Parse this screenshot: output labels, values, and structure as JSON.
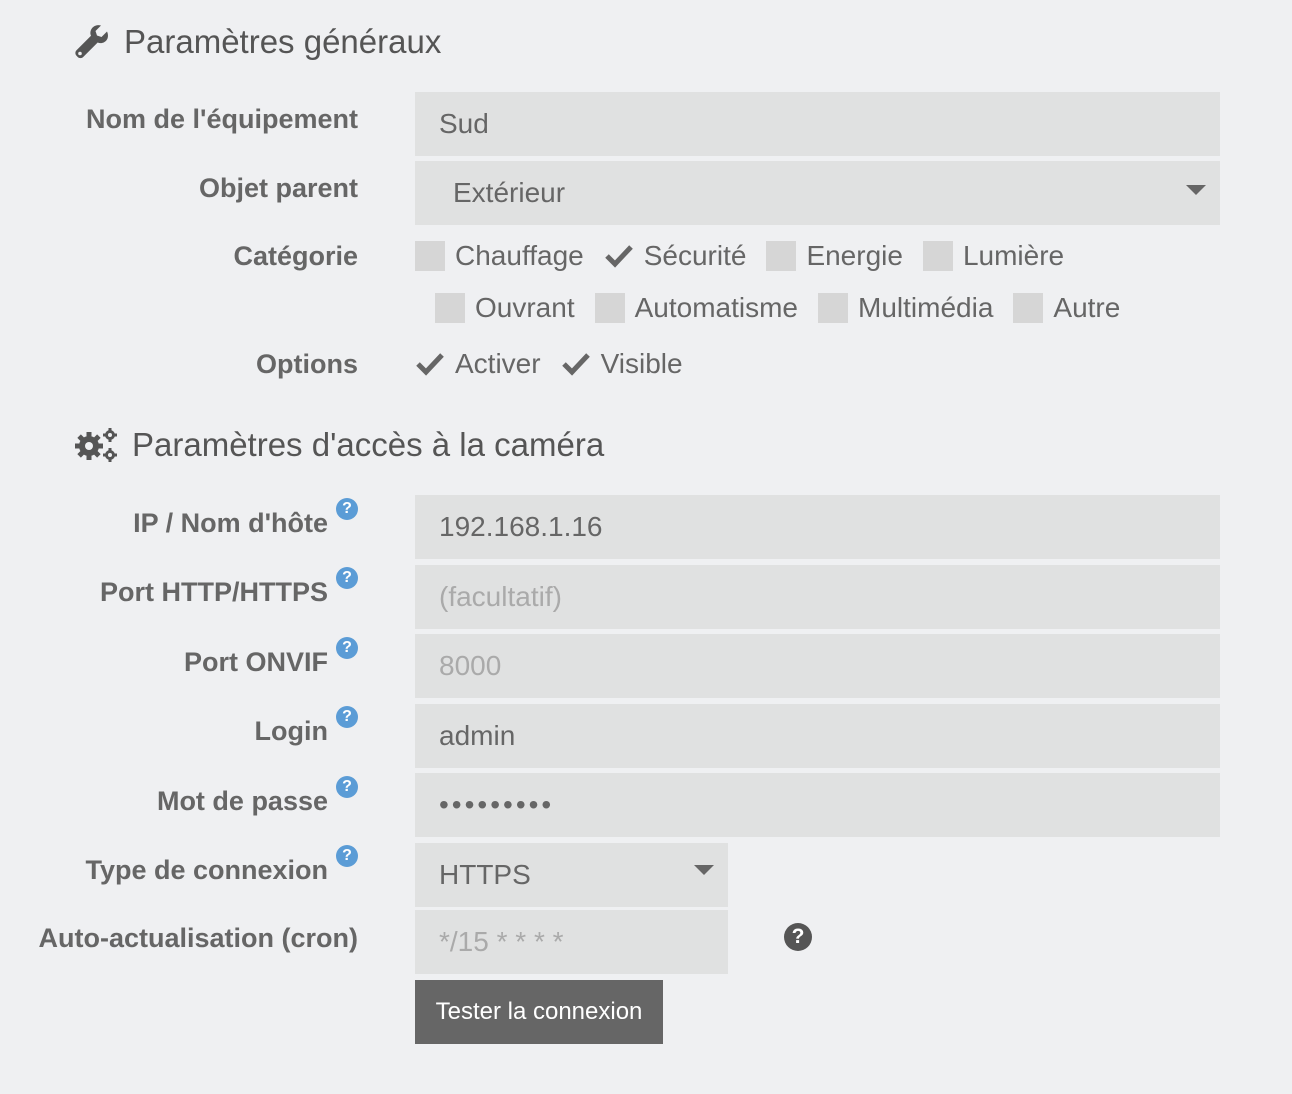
{
  "general": {
    "title": "Paramètres généraux",
    "name_label": "Nom de l'équipement",
    "name_value": "Sud",
    "parent_label": "Objet parent",
    "parent_value": "Extérieur",
    "category_label": "Catégorie",
    "categories": [
      {
        "label": "Chauffage",
        "checked": false
      },
      {
        "label": "Sécurité",
        "checked": true
      },
      {
        "label": "Energie",
        "checked": false
      },
      {
        "label": "Lumière",
        "checked": false
      },
      {
        "label": "Ouvrant",
        "checked": false
      },
      {
        "label": "Automatisme",
        "checked": false
      },
      {
        "label": "Multimédia",
        "checked": false
      },
      {
        "label": "Autre",
        "checked": false
      }
    ],
    "options_label": "Options",
    "options": [
      {
        "label": "Activer",
        "checked": true
      },
      {
        "label": "Visible",
        "checked": true
      }
    ]
  },
  "camera": {
    "title": "Paramètres d'accès à la caméra",
    "ip_label": "IP / Nom d'hôte",
    "ip_value": "192.168.1.16",
    "http_port_label": "Port HTTP/HTTPS",
    "http_port_placeholder": "(facultatif)",
    "onvif_port_label": "Port ONVIF",
    "onvif_port_placeholder": "8000",
    "login_label": "Login",
    "login_value": "admin",
    "password_label": "Mot de passe",
    "password_value": "•••••••••",
    "connection_type_label": "Type de connexion",
    "connection_type_value": "HTTPS",
    "cron_label": "Auto-actualisation (cron)",
    "cron_placeholder": "*/15 * * * *",
    "test_button": "Tester la connexion",
    "help_glyph": "?"
  },
  "icons": {
    "general": "wrench-icon",
    "camera": "gears-icon",
    "help": "question-circle-icon"
  },
  "colors": {
    "help_blue": "#5b9cd6",
    "button_bg": "#666666",
    "field_bg": "#e0e1e1"
  }
}
